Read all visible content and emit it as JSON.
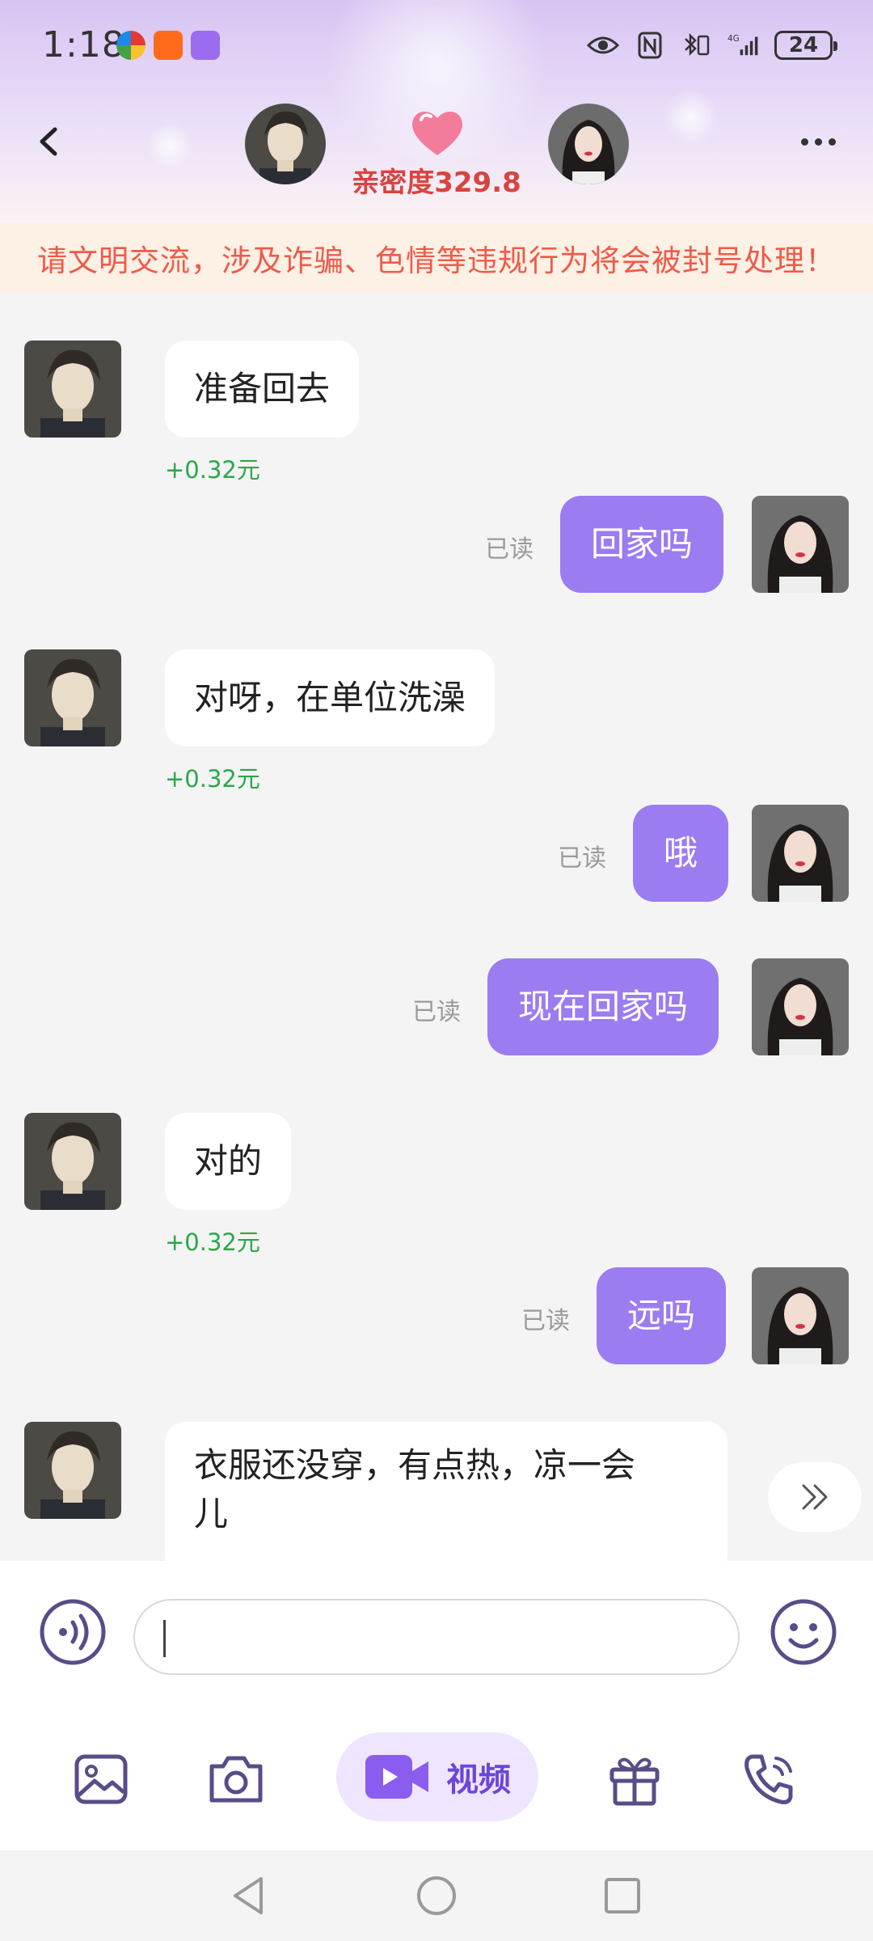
{
  "status_bar": {
    "time": "1:18",
    "network": "4G",
    "battery": "24"
  },
  "header": {
    "intimacy": "亲密度329.8"
  },
  "notice": "请文明交流，涉及诈骗、色情等违规行为将会被封号处理！",
  "messages": [
    {
      "side": "left",
      "text": "准备回去",
      "earn": "+0.32元"
    },
    {
      "side": "right",
      "text": "回家吗",
      "read": "已读"
    },
    {
      "side": "left",
      "text": "对呀，在单位洗澡",
      "earn": "+0.32元"
    },
    {
      "side": "right",
      "text": "哦",
      "read": "已读"
    },
    {
      "side": "right",
      "text": "现在回家吗",
      "read": "已读"
    },
    {
      "side": "left",
      "text": "对的",
      "earn": "+0.32元"
    },
    {
      "side": "right",
      "text": "远吗",
      "read": "已读"
    },
    {
      "side": "left",
      "text_line1": "衣服还没穿，有点热，凉一会",
      "text_line2": "儿"
    }
  ],
  "toolbar": {
    "video_label": "视频"
  },
  "icons": {
    "back": "chevron-left-icon",
    "more": "more-dots-icon",
    "heart": "heart-icon",
    "voice": "voice-icon",
    "emoji": "emoji-icon",
    "image": "image-icon",
    "camera": "camera-icon",
    "video": "video-icon",
    "gift": "gift-icon",
    "call": "phone-call-icon",
    "scroll": "double-chevron-right-icon"
  },
  "colors": {
    "accent": "#9b7cf1",
    "earn": "#2aa84a",
    "notice": "#ef5a4a",
    "intimacy": "#d8443f"
  }
}
